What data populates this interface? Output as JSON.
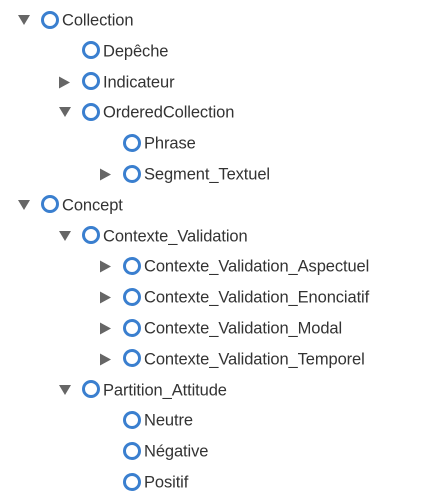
{
  "colors": {
    "class_icon": "#3a7fcf",
    "toggle_arrow": "#666666",
    "label_text": "#333333"
  },
  "icons": {
    "expanded": "triangle-down-icon",
    "collapsed": "triangle-right-icon",
    "class_node": "class-circle-icon"
  },
  "tree": [
    {
      "label": "Collection",
      "state": "expanded",
      "depth": 0
    },
    {
      "label": "Depêche",
      "state": "leaf",
      "depth": 1
    },
    {
      "label": "Indicateur",
      "state": "collapsed",
      "depth": 1
    },
    {
      "label": "OrderedCollection",
      "state": "expanded",
      "depth": 1
    },
    {
      "label": "Phrase",
      "state": "leaf",
      "depth": 2
    },
    {
      "label": "Segment_Textuel",
      "state": "collapsed",
      "depth": 2
    },
    {
      "label": "Concept",
      "state": "expanded",
      "depth": 0
    },
    {
      "label": "Contexte_Validation",
      "state": "expanded",
      "depth": 1
    },
    {
      "label": "Contexte_Validation_Aspectuel",
      "state": "collapsed",
      "depth": 2
    },
    {
      "label": "Contexte_Validation_Enonciatif",
      "state": "collapsed",
      "depth": 2
    },
    {
      "label": "Contexte_Validation_Modal",
      "state": "collapsed",
      "depth": 2
    },
    {
      "label": "Contexte_Validation_Temporel",
      "state": "collapsed",
      "depth": 2
    },
    {
      "label": "Partition_Attitude",
      "state": "expanded",
      "depth": 1
    },
    {
      "label": "Neutre",
      "state": "leaf",
      "depth": 2
    },
    {
      "label": "Négative",
      "state": "leaf",
      "depth": 2
    },
    {
      "label": "Positif",
      "state": "leaf",
      "depth": 2
    }
  ]
}
